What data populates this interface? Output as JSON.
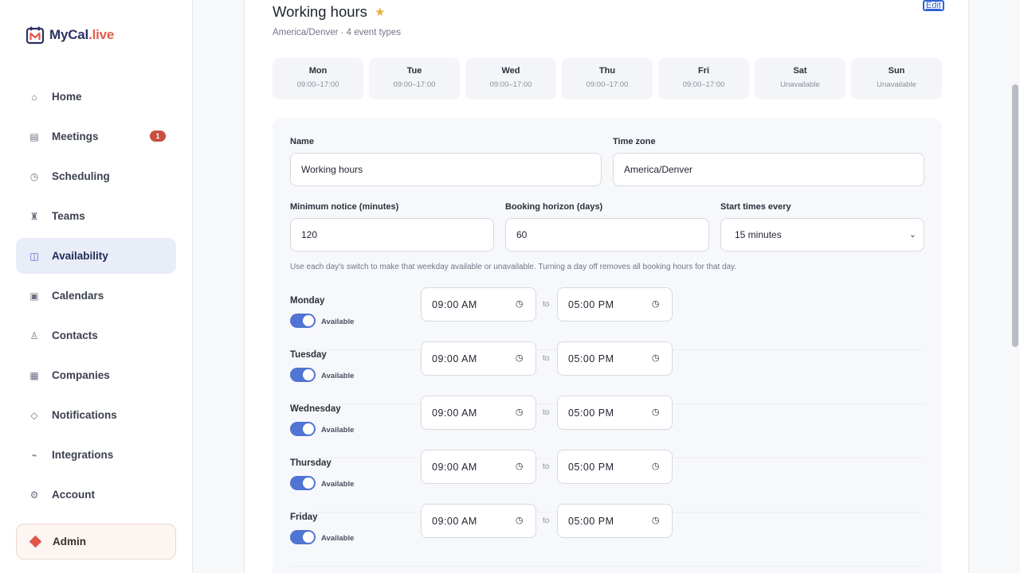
{
  "brand": {
    "name_main": "MyCal",
    "name_accent": ".live"
  },
  "sidebar": {
    "items": [
      {
        "label": "Home",
        "icon": "⌂"
      },
      {
        "label": "Meetings",
        "icon": "▤",
        "badge": "1"
      },
      {
        "label": "Scheduling",
        "icon": "◷"
      },
      {
        "label": "Teams",
        "icon": "♜"
      },
      {
        "label": "Availability",
        "icon": "◫",
        "active": true
      },
      {
        "label": "Calendars",
        "icon": "▣"
      },
      {
        "label": "Contacts",
        "icon": "♙"
      },
      {
        "label": "Companies",
        "icon": "▦"
      },
      {
        "label": "Notifications",
        "icon": "◇"
      },
      {
        "label": "Integrations",
        "icon": "⌁"
      },
      {
        "label": "Account",
        "icon": "⚙"
      }
    ],
    "admin_label": "Admin"
  },
  "schedule": {
    "title": "Working hours",
    "edit_label": "Edit",
    "subtitle": "America/Denver · 4 event types",
    "week": [
      {
        "day": "Mon",
        "hours": "09:00–17:00"
      },
      {
        "day": "Tue",
        "hours": "09:00–17:00"
      },
      {
        "day": "Wed",
        "hours": "09:00–17:00"
      },
      {
        "day": "Thu",
        "hours": "09:00–17:00"
      },
      {
        "day": "Fri",
        "hours": "09:00–17:00"
      },
      {
        "day": "Sat",
        "hours": "Unavailable"
      },
      {
        "day": "Sun",
        "hours": "Unavailable"
      }
    ]
  },
  "form": {
    "name_label": "Name",
    "name_value": "Working hours",
    "timezone_label": "Time zone",
    "timezone_value": "America/Denver",
    "notice_label": "Minimum notice (minutes)",
    "notice_value": "120",
    "horizon_label": "Booking horizon (days)",
    "horizon_value": "60",
    "interval_label": "Start times every",
    "interval_value": "15 minutes",
    "help": "Use each day's switch to make that weekday available or unavailable. Turning a day off removes all booking hours for that day.",
    "to_label": "to",
    "days": [
      {
        "name": "Monday",
        "status": "Available",
        "start": "09:00 AM",
        "end": "05:00 PM"
      },
      {
        "name": "Tuesday",
        "status": "Available",
        "start": "09:00 AM",
        "end": "05:00 PM"
      },
      {
        "name": "Wednesday",
        "status": "Available",
        "start": "09:00 AM",
        "end": "05:00 PM"
      },
      {
        "name": "Thursday",
        "status": "Available",
        "start": "09:00 AM",
        "end": "05:00 PM"
      },
      {
        "name": "Friday",
        "status": "Available",
        "start": "09:00 AM",
        "end": "05:00 PM"
      }
    ]
  },
  "colors": {
    "accent": "#4f74d3",
    "brand": "#2b3260",
    "brand_accent": "#e25b4a",
    "badge": "#c9503f",
    "star": "#e3b13b"
  }
}
